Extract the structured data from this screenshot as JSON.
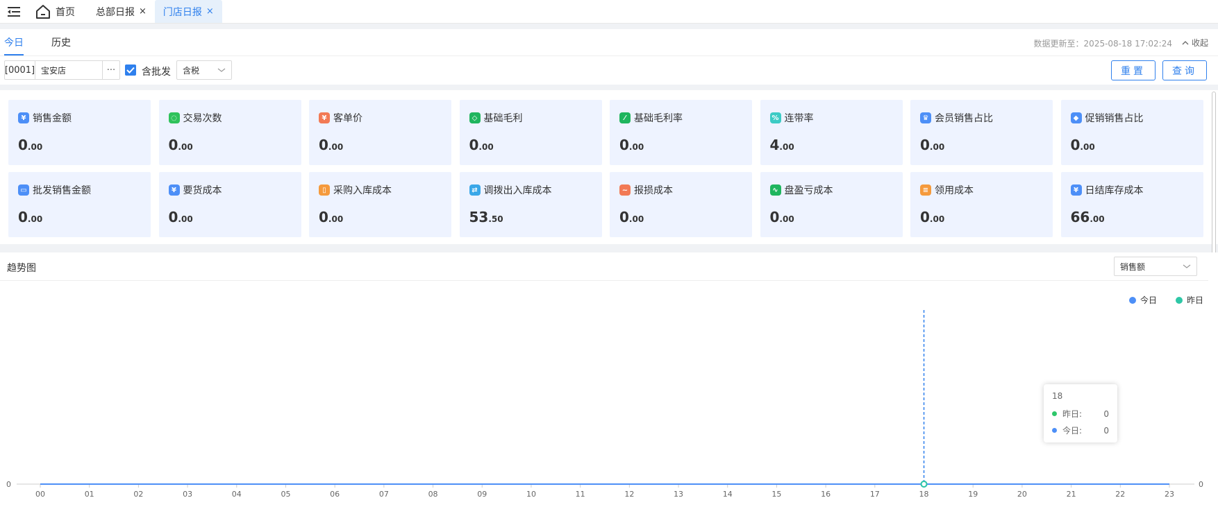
{
  "tabs": {
    "home": "首页",
    "hq": "总部日报",
    "store": "门店日报",
    "close_glyph": "×"
  },
  "subtabs": {
    "today": "今日",
    "history": "历史"
  },
  "update_info": "数据更新至：2025-08-18 17:02:24",
  "collapse_label": "收起",
  "filters": {
    "store_code": "[0001]",
    "store_name": "宝安店",
    "store_more": "···",
    "include_wholesale": "含批发",
    "tax_mode": "含税"
  },
  "buttons": {
    "reset": "重置",
    "query": "查询"
  },
  "stats": [
    {
      "label": "销售金额",
      "int": "0",
      "dec": ".00",
      "color": "#4d8ff7",
      "icon": "wallet-icon"
    },
    {
      "label": "交易次数",
      "int": "0",
      "dec": ".00",
      "color": "#2fc25b",
      "icon": "bag-icon"
    },
    {
      "label": "客单价",
      "int": "0",
      "dec": ".00",
      "color": "#f27a55",
      "icon": "yen-tag-icon"
    },
    {
      "label": "基础毛利",
      "int": "0",
      "dec": ".00",
      "color": "#1fb55e",
      "icon": "diamond-icon"
    },
    {
      "label": "基础毛利率",
      "int": "0",
      "dec": ".00",
      "color": "#1fb55e",
      "icon": "percent-badge-icon"
    },
    {
      "label": "连带率",
      "int": "4",
      "dec": ".00",
      "color": "#3ccbc5",
      "icon": "percent-icon"
    },
    {
      "label": "会员销售占比",
      "int": "0",
      "dec": ".00",
      "color": "#4d8ff7",
      "icon": "crown-icon"
    },
    {
      "label": "促销销售占比",
      "int": "0",
      "dec": ".00",
      "color": "#4d8ff7",
      "icon": "tag-icon"
    },
    {
      "label": "批发销售金额",
      "int": "0",
      "dec": ".00",
      "color": "#4d8ff7",
      "icon": "monitor-icon"
    },
    {
      "label": "要货成本",
      "int": "0",
      "dec": ".00",
      "color": "#4d8ff7",
      "icon": "yen-coin-icon"
    },
    {
      "label": "采购入库成本",
      "int": "0",
      "dec": ".00",
      "color": "#f59a3c",
      "icon": "cart-icon"
    },
    {
      "label": "调拨出入库成本",
      "int": "53",
      "dec": ".50",
      "color": "#3aa7e8",
      "icon": "transfer-icon"
    },
    {
      "label": "报损成本",
      "int": "0",
      "dec": ".00",
      "color": "#f27a55",
      "icon": "damage-icon"
    },
    {
      "label": "盘盈亏成本",
      "int": "0",
      "dec": ".00",
      "color": "#1fb55e",
      "icon": "trend-icon"
    },
    {
      "label": "领用成本",
      "int": "0",
      "dec": ".00",
      "color": "#f59a3c",
      "icon": "clipboard-icon"
    },
    {
      "label": "日结库存成本",
      "int": "66",
      "dec": ".00",
      "color": "#4d8ff7",
      "icon": "yen-coin-icon"
    }
  ],
  "trend": {
    "title": "趋势图",
    "metric": "销售额"
  },
  "tooltip": {
    "hour": "18",
    "yesterday_label": "昨日:",
    "yesterday_value": "0",
    "today_label": "今日:",
    "today_value": "0"
  },
  "chart_data": {
    "type": "line",
    "x": [
      "00",
      "01",
      "02",
      "03",
      "04",
      "05",
      "06",
      "07",
      "08",
      "09",
      "10",
      "11",
      "12",
      "13",
      "14",
      "15",
      "16",
      "17",
      "18",
      "19",
      "20",
      "21",
      "22",
      "23"
    ],
    "series": [
      {
        "name": "今日",
        "color": "#4d8ff7",
        "values": [
          0,
          0,
          0,
          0,
          0,
          0,
          0,
          0,
          0,
          0,
          0,
          0,
          0,
          0,
          0,
          0,
          0,
          0,
          0,
          0,
          0,
          0,
          0,
          0
        ]
      },
      {
        "name": "昨日",
        "color": "#2ec7a6",
        "values": [
          0,
          0,
          0,
          0,
          0,
          0,
          0,
          0,
          0,
          0,
          0,
          0,
          0,
          0,
          0,
          0,
          0,
          0,
          0,
          0,
          0,
          0,
          0,
          0
        ]
      }
    ],
    "y_tick_left": "0",
    "y_tick_right": "0",
    "highlight_x": "18",
    "legend": "top-right"
  }
}
